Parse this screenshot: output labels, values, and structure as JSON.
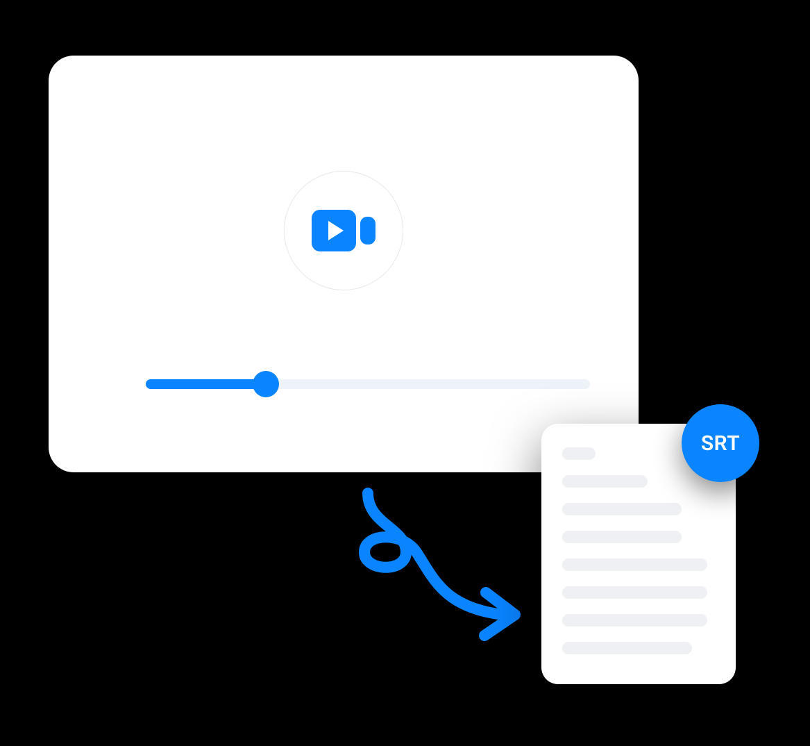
{
  "colors": {
    "accent": "#0a84ff",
    "card_bg": "#ffffff",
    "placeholder": "#eef0f3",
    "track_bg": "#edf3f9",
    "stage_bg": "#000000"
  },
  "player": {
    "progress_percent": 27
  },
  "output": {
    "badge_label": "SRT",
    "line_widths_percent": [
      22,
      56,
      78,
      78,
      95,
      95,
      95,
      85
    ]
  }
}
